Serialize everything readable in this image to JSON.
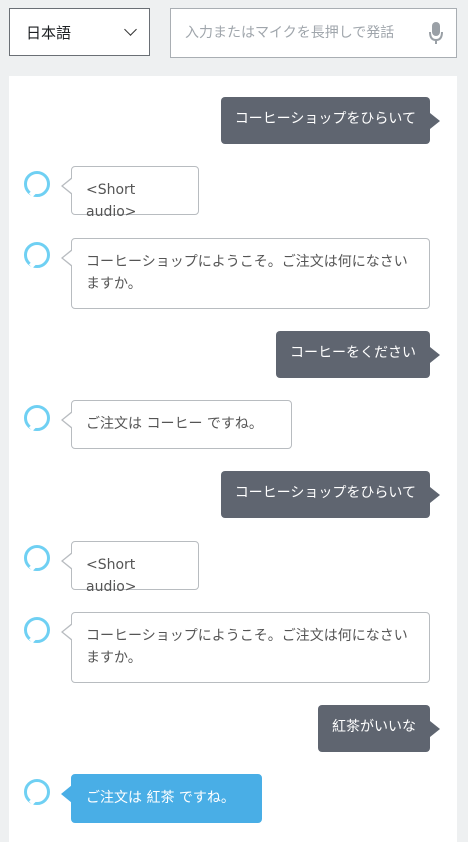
{
  "language_select": {
    "value": "日本語"
  },
  "input": {
    "placeholder": "入力またはマイクを長押しで発話"
  },
  "messages": [
    {
      "role": "user",
      "text": "コーヒーショップをひらいて"
    },
    {
      "role": "alexa",
      "text": "<Short audio>"
    },
    {
      "role": "alexa",
      "text": "コーヒーショップにようこそ。ご注文は何になさいますか。"
    },
    {
      "role": "user",
      "text": "コーヒーをください"
    },
    {
      "role": "alexa",
      "text": "ご注文は コーヒー ですね。"
    },
    {
      "role": "user",
      "text": "コーヒーショップをひらいて"
    },
    {
      "role": "alexa",
      "text": "<Short audio>"
    },
    {
      "role": "alexa",
      "text": "コーヒーショップにようこそ。ご注文は何になさいますか。"
    },
    {
      "role": "user",
      "text": "紅茶がいいな"
    },
    {
      "role": "alexa",
      "text": "ご注文は 紅茶 ですね。",
      "highlight": true
    }
  ]
}
